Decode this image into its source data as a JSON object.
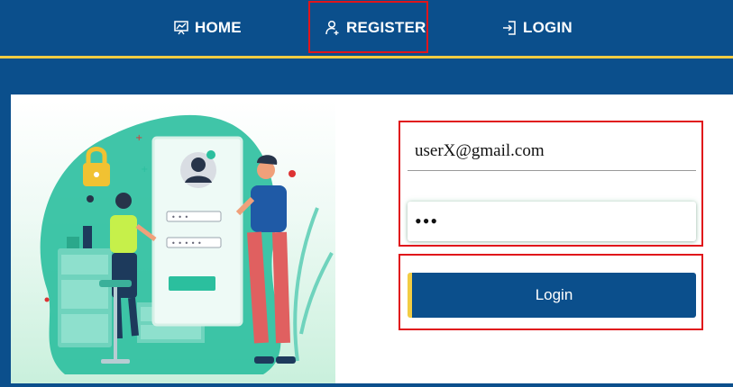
{
  "nav": {
    "home_label": "HOME",
    "register_label": "REGISTER",
    "login_label": "LOGIN"
  },
  "form": {
    "email_value": "userX@gmail.com",
    "password_mask": "•••",
    "login_button": "Login"
  },
  "colors": {
    "brand_blue": "#0b4f8c",
    "accent_yellow": "#f2cc43",
    "highlight_red": "#e0151b",
    "illustration_teal": "#2bbf9e"
  },
  "icons": {
    "home": "presentation-chart-icon",
    "register": "user-add-icon",
    "login": "sign-in-icon"
  }
}
